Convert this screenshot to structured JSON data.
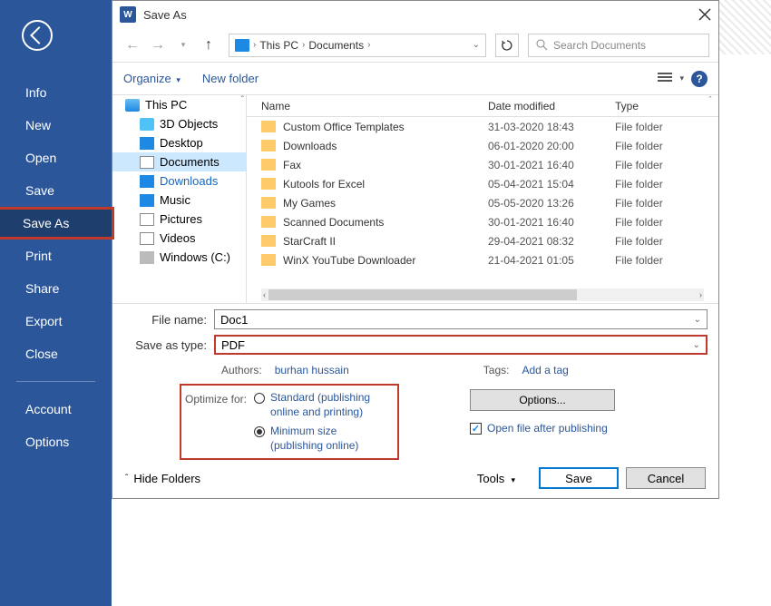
{
  "sidebar": {
    "items": [
      "Info",
      "New",
      "Open",
      "Save",
      "Save As",
      "Print",
      "Share",
      "Export",
      "Close"
    ],
    "items2": [
      "Account",
      "Options"
    ]
  },
  "dialog": {
    "title": "Save As",
    "breadcrumb": {
      "pc": "This PC",
      "folder": "Documents"
    },
    "search_placeholder": "Search Documents",
    "organize": "Organize",
    "new_folder": "New folder",
    "tree": {
      "root": "This PC",
      "items": [
        "3D Objects",
        "Desktop",
        "Documents",
        "Downloads",
        "Music",
        "Pictures",
        "Videos",
        "Windows (C:)"
      ]
    },
    "columns": {
      "name": "Name",
      "date": "Date modified",
      "type": "Type"
    },
    "files": [
      {
        "name": "Custom Office Templates",
        "date": "31-03-2020 18:43",
        "type": "File folder"
      },
      {
        "name": "Downloads",
        "date": "06-01-2020 20:00",
        "type": "File folder"
      },
      {
        "name": "Fax",
        "date": "30-01-2021 16:40",
        "type": "File folder"
      },
      {
        "name": "Kutools for Excel",
        "date": "05-04-2021 15:04",
        "type": "File folder"
      },
      {
        "name": "My Games",
        "date": "05-05-2020 13:26",
        "type": "File folder"
      },
      {
        "name": "Scanned Documents",
        "date": "30-01-2021 16:40",
        "type": "File folder"
      },
      {
        "name": "StarCraft II",
        "date": "29-04-2021 08:32",
        "type": "File folder"
      },
      {
        "name": "WinX YouTube Downloader",
        "date": "21-04-2021 01:05",
        "type": "File folder"
      }
    ],
    "filename_label": "File name:",
    "filename": "Doc1",
    "type_label": "Save as type:",
    "type_value": "PDF",
    "authors_label": "Authors:",
    "authors": "burhan hussain",
    "tags_label": "Tags:",
    "tags": "Add a tag",
    "optimize_label": "Optimize for:",
    "opt_standard": "Standard (publishing online and printing)",
    "opt_min": "Minimum size (publishing online)",
    "options_btn": "Options...",
    "open_after": "Open file after publishing",
    "hide_folders": "Hide Folders",
    "tools": "Tools",
    "save": "Save",
    "cancel": "Cancel"
  }
}
